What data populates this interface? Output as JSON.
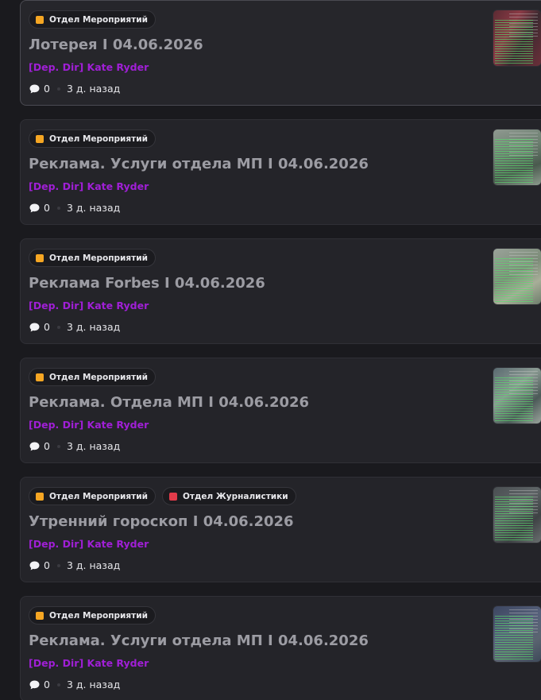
{
  "colors": {
    "author": "#a01fd6",
    "tag_events": "#f5a623",
    "tag_journalism": "#e23b4a"
  },
  "posts": [
    {
      "tags": [
        {
          "label": "Отдел Мероприятий",
          "color": "#f5a623"
        }
      ],
      "title": "Лотерея I 04.06.2026",
      "author": "[Dep. Dir] Kate Ryder",
      "comments": "0",
      "time": "3 д. назад"
    },
    {
      "tags": [
        {
          "label": "Отдел Мероприятий",
          "color": "#f5a623"
        }
      ],
      "title": "Реклама. Услуги отдела МП I 04.06.2026",
      "author": "[Dep. Dir] Kate Ryder",
      "comments": "0",
      "time": "3 д. назад"
    },
    {
      "tags": [
        {
          "label": "Отдел Мероприятий",
          "color": "#f5a623"
        }
      ],
      "title": "Реклама Forbes I 04.06.2026",
      "author": "[Dep. Dir] Kate Ryder",
      "comments": "0",
      "time": "3 д. назад"
    },
    {
      "tags": [
        {
          "label": "Отдел Мероприятий",
          "color": "#f5a623"
        }
      ],
      "title": "Реклама. Отдела МП I 04.06.2026",
      "author": "[Dep. Dir] Kate Ryder",
      "comments": "0",
      "time": "3 д. назад"
    },
    {
      "tags": [
        {
          "label": "Отдел Мероприятий",
          "color": "#f5a623"
        },
        {
          "label": "Отдел Журналистики",
          "color": "#e23b4a"
        }
      ],
      "title": "Утренний гороскоп I 04.06.2026",
      "author": "[Dep. Dir] Kate Ryder",
      "comments": "0",
      "time": "3 д. назад"
    },
    {
      "tags": [
        {
          "label": "Отдел Мероприятий",
          "color": "#f5a623"
        }
      ],
      "title": "Реклама. Услуги отдела МП I 04.06.2026",
      "author": "[Dep. Dir] Kate Ryder",
      "comments": "0",
      "time": "3 д. назад"
    }
  ]
}
